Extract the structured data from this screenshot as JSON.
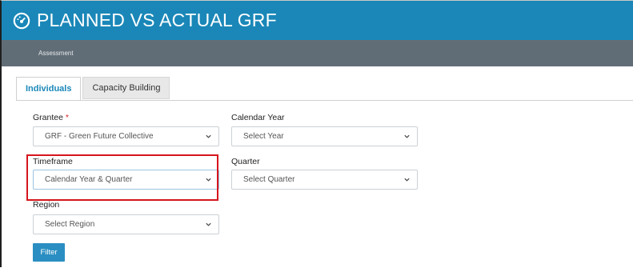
{
  "header": {
    "title": "PLANNED VS ACTUAL GRF",
    "icon": "dashboard-gauge-icon"
  },
  "subbar": {
    "breadcrumb": "Assessment"
  },
  "tabs": [
    {
      "label": "Individuals",
      "active": true
    },
    {
      "label": "Capacity Building",
      "active": false
    }
  ],
  "form": {
    "grantee": {
      "label": "Grantee",
      "required_mark": "*",
      "value": "GRF - Green Future Collective"
    },
    "calendar_year": {
      "label": "Calendar Year",
      "value": "Select Year"
    },
    "timeframe": {
      "label": "Timeframe",
      "value": "Calendar Year & Quarter"
    },
    "quarter": {
      "label": "Quarter",
      "value": "Select Quarter"
    },
    "region": {
      "label": "Region",
      "value": "Select Region"
    }
  },
  "actions": {
    "filter_label": "Filter"
  },
  "colors": {
    "header_bg": "#1a87b8",
    "subbar_bg": "#616d76",
    "accent": "#1a87b8",
    "highlight": "#d6151d",
    "button": "#2a8ec2"
  }
}
